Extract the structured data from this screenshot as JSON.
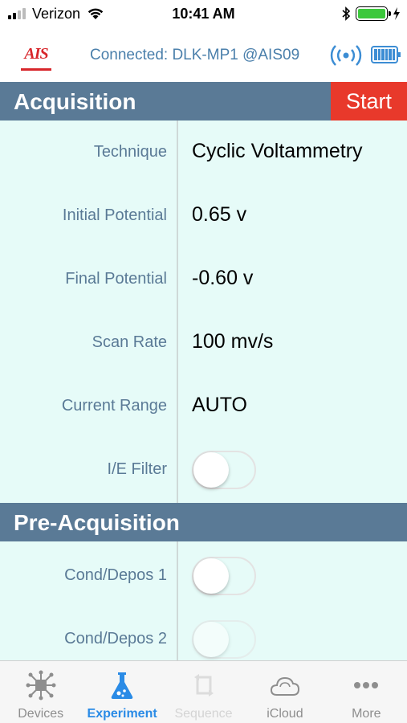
{
  "status_bar": {
    "carrier": "Verizon",
    "time": "10:41 AM",
    "battery_color": "#3cc83c"
  },
  "header": {
    "logo_text": "AIS",
    "connection_status": "Connected: DLK-MP1 @AIS09",
    "accent_color": "#4a7fab",
    "icons": [
      "wireless-signal-icon",
      "device-battery-icon"
    ]
  },
  "acquisition": {
    "title": "Acquisition",
    "start_label": "Start",
    "start_color": "#e8392b",
    "rows": [
      {
        "label": "Technique",
        "value": "Cyclic Voltammetry"
      },
      {
        "label": "Initial Potential",
        "value": "0.65 v"
      },
      {
        "label": "Final Potential",
        "value": "-0.60 v"
      },
      {
        "label": "Scan Rate",
        "value": "100 mv/s"
      },
      {
        "label": "Current Range",
        "value": "AUTO"
      }
    ],
    "ie_filter": {
      "label": "I/E Filter",
      "on": false
    }
  },
  "pre_acquisition": {
    "title": "Pre-Acquisition",
    "rows": [
      {
        "label": "Cond/Depos 1",
        "on": false
      },
      {
        "label": "Cond/Depos 2",
        "on": false
      }
    ]
  },
  "tab_bar": {
    "active_color": "#2a8be6",
    "tabs": [
      {
        "label": "Devices",
        "icon": "devices-icon",
        "state": "normal"
      },
      {
        "label": "Experiment",
        "icon": "flask-icon",
        "state": "active"
      },
      {
        "label": "Sequence",
        "icon": "sequence-icon",
        "state": "disabled"
      },
      {
        "label": "iCloud",
        "icon": "cloud-icon",
        "state": "normal"
      },
      {
        "label": "More",
        "icon": "more-icon",
        "state": "normal"
      }
    ]
  }
}
